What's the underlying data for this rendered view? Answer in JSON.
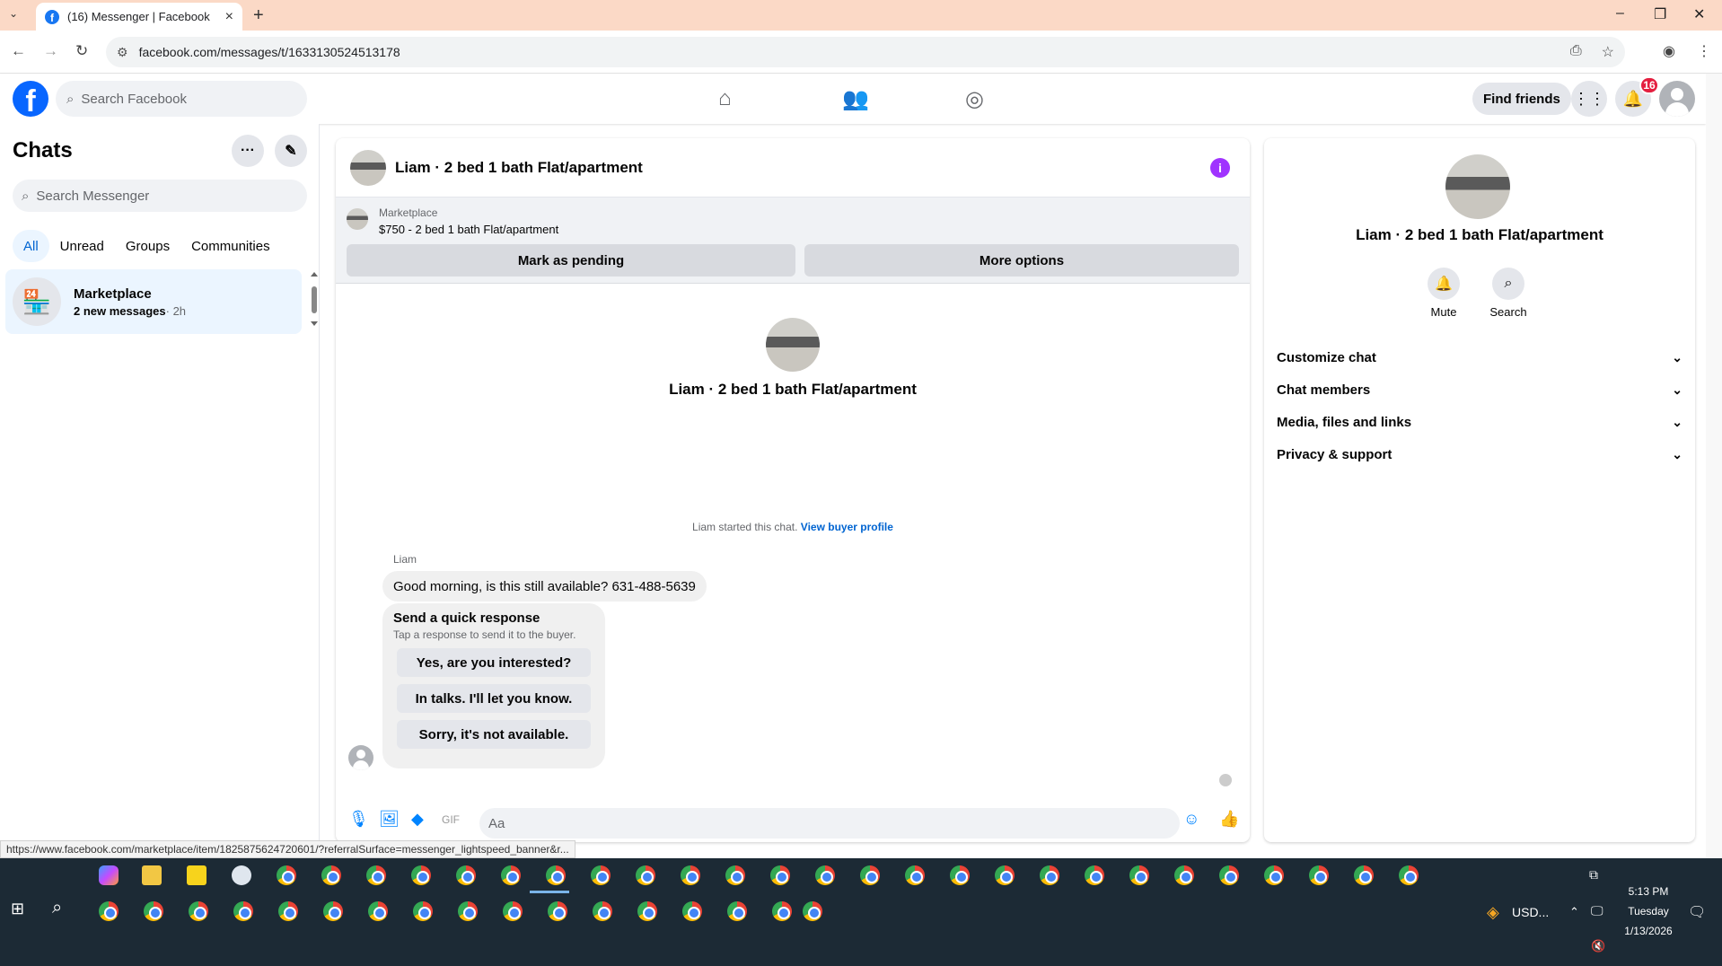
{
  "browser": {
    "tab_title": "(16) Messenger | Facebook",
    "url": "facebook.com/messages/t/1633130524513178"
  },
  "fb": {
    "search_placeholder": "Search Facebook",
    "find_friends": "Find friends",
    "notification_count": "16"
  },
  "sidebar": {
    "title": "Chats",
    "search_placeholder": "Search Messenger",
    "filters": [
      "All",
      "Unread",
      "Groups",
      "Communities"
    ],
    "chat": {
      "name": "Marketplace",
      "preview": "2 new messages",
      "time": "· 2h"
    }
  },
  "conversation": {
    "title": "Liam · 2 bed 1 bath Flat/apartment",
    "marketplace_label": "Marketplace",
    "listing": "$750 - 2 bed 1 bath Flat/apartment",
    "mark_pending": "Mark as pending",
    "more_options": "More options",
    "started_text": "Liam started this chat.",
    "view_buyer_profile": "View buyer profile",
    "sender": "Liam",
    "message": "Good morning, is this still available? 631-488-5639",
    "quick_title": "Send a quick response",
    "quick_sub": "Tap a response to send it to the buyer.",
    "quick_replies": [
      "Yes, are you interested?",
      "In talks. I'll let you know.",
      "Sorry, it's not available."
    ],
    "composer_placeholder": "Aa"
  },
  "details": {
    "name": "Liam · 2 bed 1 bath Flat/apartment",
    "mute": "Mute",
    "search": "Search",
    "sections": [
      "Customize chat",
      "Chat members",
      "Media, files and links",
      "Privacy & support"
    ]
  },
  "status_url": "https://www.facebook.com/marketplace/item/1825875624720601/?referralSurface=messenger_lightspeed_banner&r...",
  "taskbar": {
    "time": "5:13 PM",
    "day": "Tuesday",
    "date": "1/13/2026",
    "currency": "USD..."
  },
  "colors": {
    "fb_blue": "#0866ff",
    "messenger_blue": "#0084ff",
    "selected_bg": "#ebf5ff",
    "badge_red": "#e41e3f",
    "info_purple": "#a033ff"
  }
}
